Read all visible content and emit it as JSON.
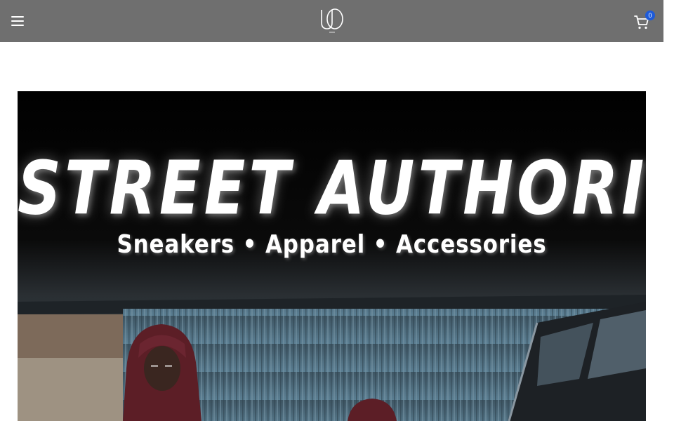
{
  "header": {
    "background": "#6f6f6f",
    "menu_icon": "hamburger-menu-icon",
    "logo_icon": "brand-logo",
    "cart_icon": "shopping-cart-icon",
    "cart_count": "0",
    "cart_badge_color": "#1e5bd9"
  },
  "banner": {
    "title": "STREET AUTHORITY",
    "subtitle": "Sneakers • Apparel • Accessories"
  }
}
